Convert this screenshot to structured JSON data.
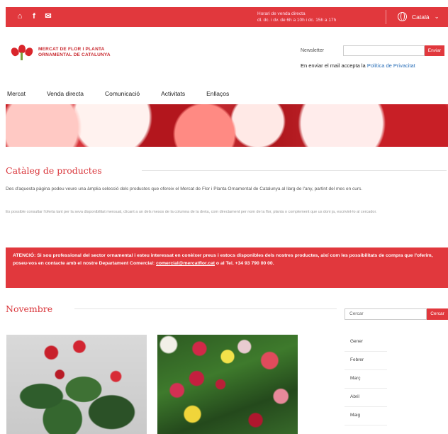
{
  "topbar": {
    "social_icons": [
      "home-icon",
      "facebook-icon",
      "mail-icon"
    ],
    "hours_line1": "Horari de venda directa",
    "hours_line2": "dl. dc. i dv. de 6h a 10h i dc. 15h a 17h",
    "language": "Català"
  },
  "header": {
    "logo_line1": "MERCAT DE FLOR I PLANTA",
    "logo_line2": "ORNAMENTAL DE CATALUNYA",
    "newsletter_label": "Newsletter",
    "newsletter_button": "Enviar",
    "newsletter_note": "En enviar el mail accepta la ",
    "newsletter_link": "Política de Privacitat"
  },
  "nav": [
    "Mercat",
    "Venda directa",
    "Comunicació",
    "Activitats",
    "Enllaços"
  ],
  "catalog": {
    "title": "Catàleg de productes",
    "intro": "Des d'aquesta pàgina podeu veure una àmplia selecció dels productes que ofereix el Mercat de Flor i Planta Ornamental de Catalunya al llarg de l'any, partint del mes en curs.",
    "hint": "Es possible consultar l'oferta tant per la seva disponibilitat mensual, clicant a un dels mesos de la columna de la dreta, com directament per nom de la flor, planta o complement que us doni ja, escrivint-lo al cercador.",
    "alert_prefix": "ATENCIÓ: Si sou professional del sector ornamental i esteu interessat en conèixer preus i estocs disponibles dels nostres productes, així com les possibilitats de compra que l'oferim, poseu-vos en contacte amb el nostre Departament Comercial: ",
    "alert_email": "comercial@mercatflor.cat",
    "alert_suffix": " o al Tel. +34 93 790 00 00."
  },
  "month_section": {
    "title": "Novembre",
    "search_placeholder": "Cercar",
    "search_button": "Cercar",
    "months": [
      "Gener",
      "Febrer",
      "Març",
      "Abril",
      "Maig"
    ]
  },
  "colors": {
    "brand_red": "#e1383d",
    "link_blue": "#2a6fb8"
  }
}
